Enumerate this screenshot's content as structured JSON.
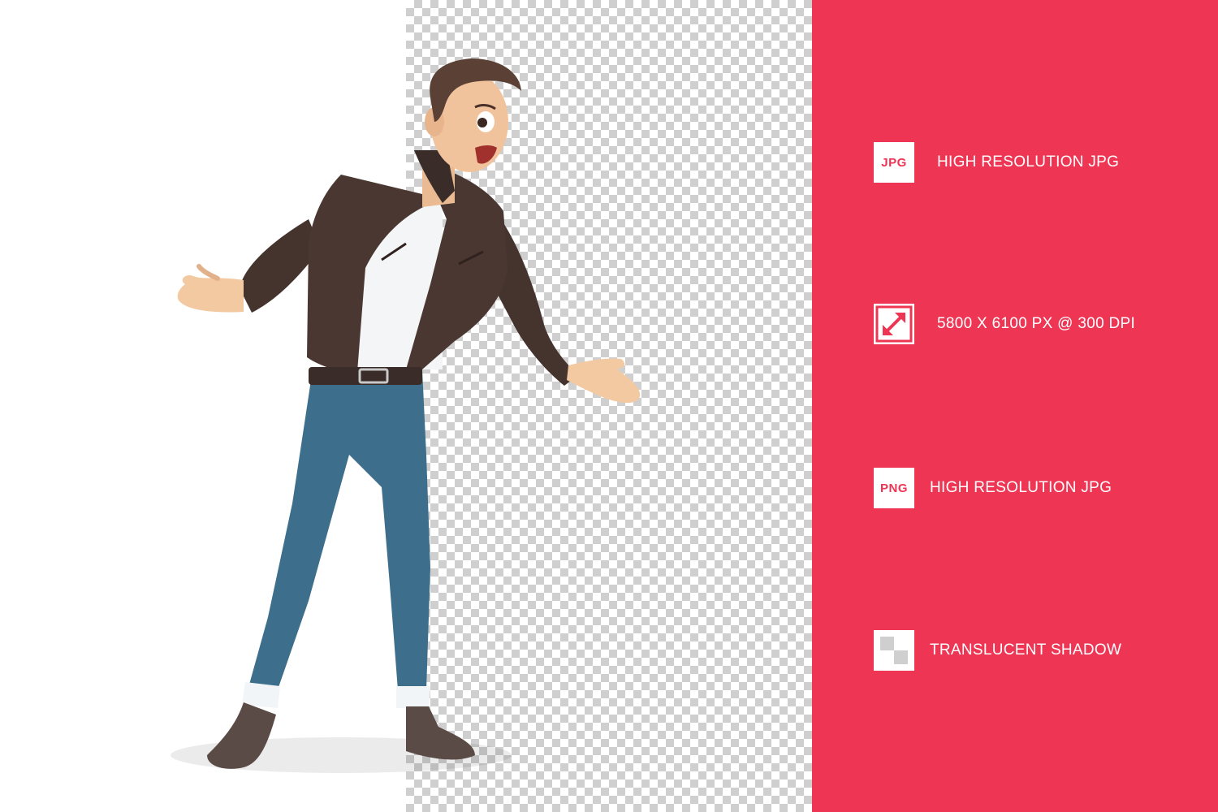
{
  "features": [
    {
      "icon": "jpg-badge-icon",
      "icon_text": "JPG",
      "label": "HIGH RESOLUTION JPG"
    },
    {
      "icon": "resize-arrows-icon",
      "label": "5800 X 6100 PX @ 300 DPI"
    },
    {
      "icon": "png-badge-icon",
      "icon_text": "PNG",
      "label": "HIGH RESOLUTION JPG"
    },
    {
      "icon": "checkerboard-icon",
      "label": "TRANSLUCENT SHADOW"
    }
  ],
  "colors": {
    "accent": "#ee3654",
    "checker_dark": "#cfcfcf",
    "jacket": "#4a3732",
    "jeans": "#3d6f8c"
  }
}
